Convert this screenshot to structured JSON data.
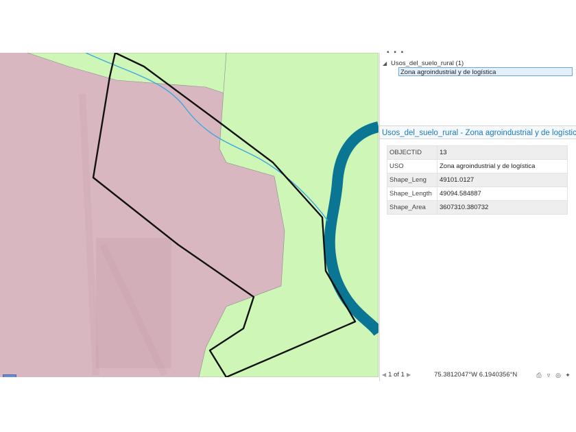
{
  "tree": {
    "dots": "▪ ▪ ▪",
    "layer_label": "Usos_del_suelo_rural  (1)",
    "feature_label": "Zona agroindustrial y de logística"
  },
  "attributes": {
    "title": "Usos_del_suelo_rural - Zona agroindustrial y de logística",
    "rows": [
      {
        "field": "OBJECTID",
        "value": "13"
      },
      {
        "field": "USO",
        "value": "Zona agroindustrial y de logística"
      },
      {
        "field": "Shape_Leng",
        "value": "49101.0127"
      },
      {
        "field": "Shape_Length",
        "value": "49094.584887"
      },
      {
        "field": "Shape_Area",
        "value": "3607310.380732"
      }
    ]
  },
  "status": {
    "page": "1 of 1",
    "coords": "75.3812047°W 6.1940356°N",
    "tools": [
      "print-icon",
      "filter-icon",
      "select-icon",
      "add-icon"
    ]
  },
  "colors": {
    "green_zone": "#cdf5b4",
    "pink_zone": "#dbb9c3",
    "river": "#0a7594",
    "stream": "#3aa7e0",
    "outline": "#111111",
    "accent": "#1a79b8"
  }
}
